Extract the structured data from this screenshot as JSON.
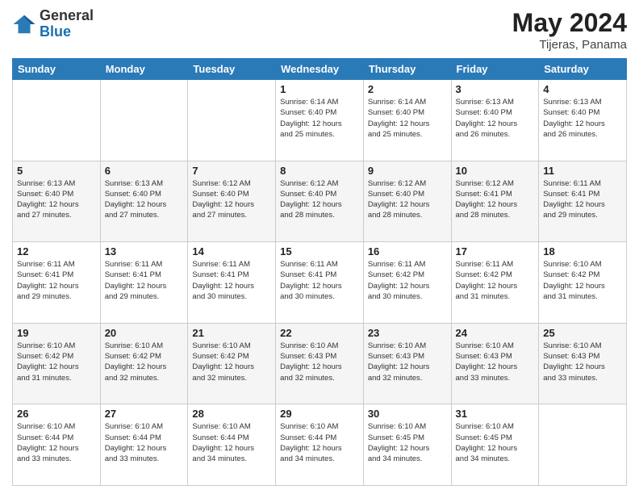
{
  "header": {
    "logo_line1": "General",
    "logo_line2": "Blue",
    "title": "May 2024",
    "location": "Tijeras, Panama"
  },
  "weekdays": [
    "Sunday",
    "Monday",
    "Tuesday",
    "Wednesday",
    "Thursday",
    "Friday",
    "Saturday"
  ],
  "weeks": [
    [
      {
        "day": "",
        "info": ""
      },
      {
        "day": "",
        "info": ""
      },
      {
        "day": "",
        "info": ""
      },
      {
        "day": "1",
        "info": "Sunrise: 6:14 AM\nSunset: 6:40 PM\nDaylight: 12 hours\nand 25 minutes."
      },
      {
        "day": "2",
        "info": "Sunrise: 6:14 AM\nSunset: 6:40 PM\nDaylight: 12 hours\nand 25 minutes."
      },
      {
        "day": "3",
        "info": "Sunrise: 6:13 AM\nSunset: 6:40 PM\nDaylight: 12 hours\nand 26 minutes."
      },
      {
        "day": "4",
        "info": "Sunrise: 6:13 AM\nSunset: 6:40 PM\nDaylight: 12 hours\nand 26 minutes."
      }
    ],
    [
      {
        "day": "5",
        "info": "Sunrise: 6:13 AM\nSunset: 6:40 PM\nDaylight: 12 hours\nand 27 minutes."
      },
      {
        "day": "6",
        "info": "Sunrise: 6:13 AM\nSunset: 6:40 PM\nDaylight: 12 hours\nand 27 minutes."
      },
      {
        "day": "7",
        "info": "Sunrise: 6:12 AM\nSunset: 6:40 PM\nDaylight: 12 hours\nand 27 minutes."
      },
      {
        "day": "8",
        "info": "Sunrise: 6:12 AM\nSunset: 6:40 PM\nDaylight: 12 hours\nand 28 minutes."
      },
      {
        "day": "9",
        "info": "Sunrise: 6:12 AM\nSunset: 6:40 PM\nDaylight: 12 hours\nand 28 minutes."
      },
      {
        "day": "10",
        "info": "Sunrise: 6:12 AM\nSunset: 6:41 PM\nDaylight: 12 hours\nand 28 minutes."
      },
      {
        "day": "11",
        "info": "Sunrise: 6:11 AM\nSunset: 6:41 PM\nDaylight: 12 hours\nand 29 minutes."
      }
    ],
    [
      {
        "day": "12",
        "info": "Sunrise: 6:11 AM\nSunset: 6:41 PM\nDaylight: 12 hours\nand 29 minutes."
      },
      {
        "day": "13",
        "info": "Sunrise: 6:11 AM\nSunset: 6:41 PM\nDaylight: 12 hours\nand 29 minutes."
      },
      {
        "day": "14",
        "info": "Sunrise: 6:11 AM\nSunset: 6:41 PM\nDaylight: 12 hours\nand 30 minutes."
      },
      {
        "day": "15",
        "info": "Sunrise: 6:11 AM\nSunset: 6:41 PM\nDaylight: 12 hours\nand 30 minutes."
      },
      {
        "day": "16",
        "info": "Sunrise: 6:11 AM\nSunset: 6:42 PM\nDaylight: 12 hours\nand 30 minutes."
      },
      {
        "day": "17",
        "info": "Sunrise: 6:11 AM\nSunset: 6:42 PM\nDaylight: 12 hours\nand 31 minutes."
      },
      {
        "day": "18",
        "info": "Sunrise: 6:10 AM\nSunset: 6:42 PM\nDaylight: 12 hours\nand 31 minutes."
      }
    ],
    [
      {
        "day": "19",
        "info": "Sunrise: 6:10 AM\nSunset: 6:42 PM\nDaylight: 12 hours\nand 31 minutes."
      },
      {
        "day": "20",
        "info": "Sunrise: 6:10 AM\nSunset: 6:42 PM\nDaylight: 12 hours\nand 32 minutes."
      },
      {
        "day": "21",
        "info": "Sunrise: 6:10 AM\nSunset: 6:42 PM\nDaylight: 12 hours\nand 32 minutes."
      },
      {
        "day": "22",
        "info": "Sunrise: 6:10 AM\nSunset: 6:43 PM\nDaylight: 12 hours\nand 32 minutes."
      },
      {
        "day": "23",
        "info": "Sunrise: 6:10 AM\nSunset: 6:43 PM\nDaylight: 12 hours\nand 32 minutes."
      },
      {
        "day": "24",
        "info": "Sunrise: 6:10 AM\nSunset: 6:43 PM\nDaylight: 12 hours\nand 33 minutes."
      },
      {
        "day": "25",
        "info": "Sunrise: 6:10 AM\nSunset: 6:43 PM\nDaylight: 12 hours\nand 33 minutes."
      }
    ],
    [
      {
        "day": "26",
        "info": "Sunrise: 6:10 AM\nSunset: 6:44 PM\nDaylight: 12 hours\nand 33 minutes."
      },
      {
        "day": "27",
        "info": "Sunrise: 6:10 AM\nSunset: 6:44 PM\nDaylight: 12 hours\nand 33 minutes."
      },
      {
        "day": "28",
        "info": "Sunrise: 6:10 AM\nSunset: 6:44 PM\nDaylight: 12 hours\nand 34 minutes."
      },
      {
        "day": "29",
        "info": "Sunrise: 6:10 AM\nSunset: 6:44 PM\nDaylight: 12 hours\nand 34 minutes."
      },
      {
        "day": "30",
        "info": "Sunrise: 6:10 AM\nSunset: 6:45 PM\nDaylight: 12 hours\nand 34 minutes."
      },
      {
        "day": "31",
        "info": "Sunrise: 6:10 AM\nSunset: 6:45 PM\nDaylight: 12 hours\nand 34 minutes."
      },
      {
        "day": "",
        "info": ""
      }
    ]
  ]
}
